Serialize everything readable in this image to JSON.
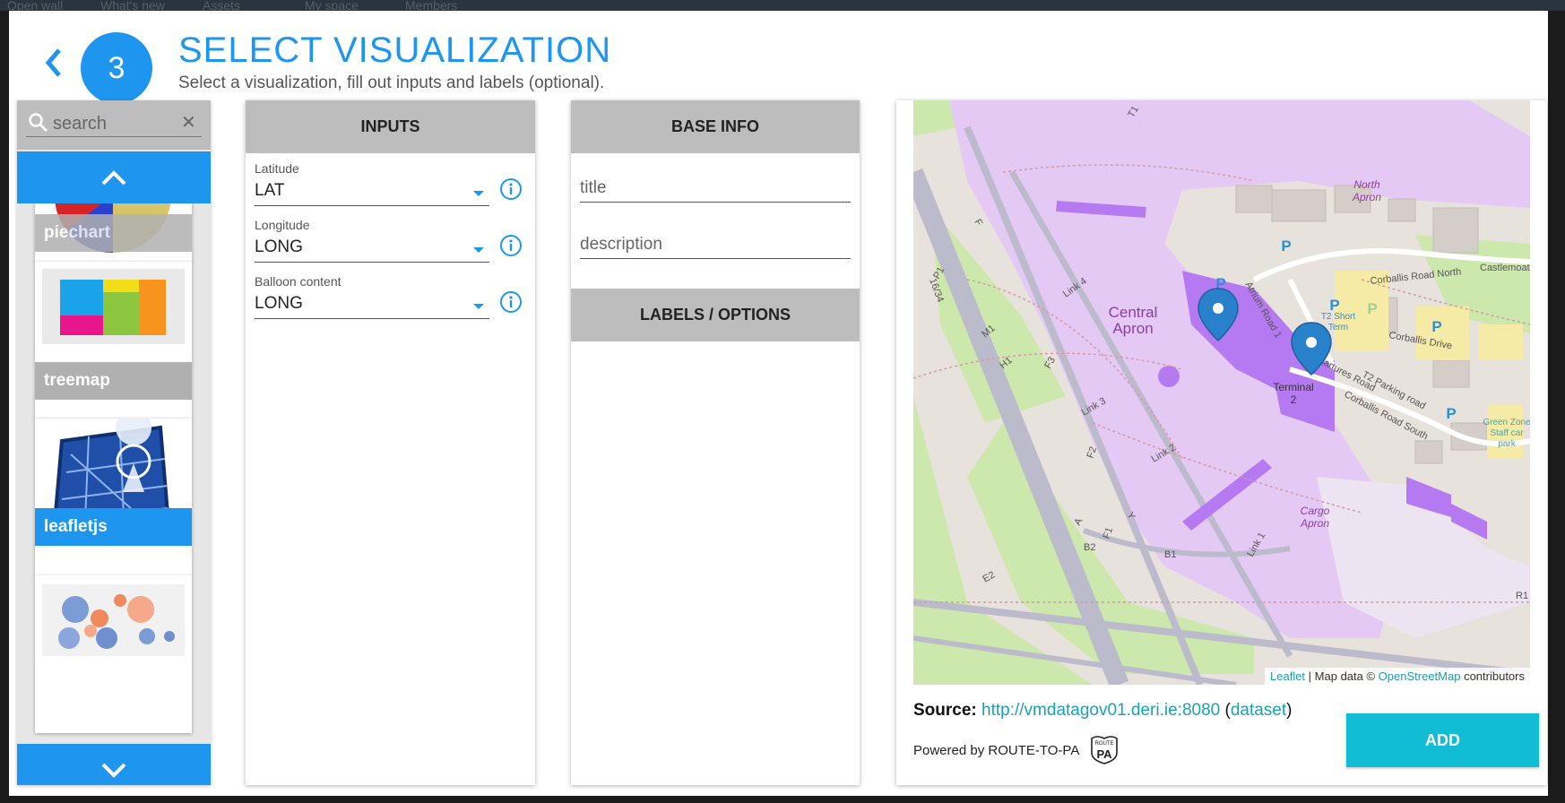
{
  "background_nav": [
    "Open wall",
    "What's new",
    "Assets",
    "My space",
    "Members"
  ],
  "header": {
    "step_number": "3",
    "title": "SELECT VISUALIZATION",
    "subtitle": "Select a visualization, fill out inputs and labels (optional)."
  },
  "gallery": {
    "search_placeholder": "search",
    "clear_glyph": "✕",
    "items": [
      {
        "label": "piechart",
        "selected": false
      },
      {
        "label": "treemap",
        "selected": false
      },
      {
        "label": "leafletjs",
        "selected": true
      },
      {
        "label": "",
        "selected": false
      }
    ]
  },
  "inputs_panel": {
    "heading": "INPUTS",
    "fields": [
      {
        "label": "Latitude",
        "value": "LAT"
      },
      {
        "label": "Longitude",
        "value": "LONG"
      },
      {
        "label": "Balloon content",
        "value": "LONG"
      }
    ]
  },
  "base_panel": {
    "heading": "BASE INFO",
    "title_placeholder": "title",
    "description_placeholder": "description",
    "labels_heading": "LABELS / OPTIONS"
  },
  "preview": {
    "map_labels": {
      "central_apron_1": "Central",
      "central_apron_2": "Apron",
      "north_apron_1": "North",
      "north_apron_2": "Apron",
      "cargo_apron_1": "Cargo",
      "cargo_apron_2": "Apron",
      "terminal_1": "Terminal",
      "terminal_2": "2",
      "link4": "Link 4",
      "link3": "Link 3",
      "link2": "Link 2",
      "link1": "Link 1",
      "runway": "16/34",
      "corballis_north": "Corballis Road North",
      "corballis_south": "Corballis Road South",
      "corballis_drive": "Corballis Drive",
      "t2_departures": "T2 Departures Road",
      "t2_parking": "T2 Parking road",
      "atrium_road": "Atrium Road 1",
      "castlemoat": "Castlemoat",
      "t2_short_term_1": "T2 Short",
      "t2_short_term_2": "Term",
      "green_zone_1": "Green Zone",
      "green_zone_2": "Staff car",
      "green_zone_3": "park",
      "p": "P",
      "m1": "M1",
      "h1": "H1",
      "f3": "F3",
      "f2": "F2",
      "f1": "F1",
      "p1": "P1",
      "b1": "B1",
      "b2": "B2",
      "e2": "E2",
      "t1": "T1",
      "f": "F",
      "a": "A",
      "y": "Y",
      "r1": "R1"
    },
    "attribution": {
      "leaflet": "Leaflet",
      "sep": " | Map data © ",
      "osm": "OpenStreetMap",
      "suffix": " contributors"
    },
    "source_label": "Source:",
    "source_url": "http://vmdatagov01.deri.ie:8080",
    "open_paren": " (",
    "dataset_link": "dataset",
    "close_paren": ")",
    "powered_by": "Powered by ROUTE-TO-PA",
    "badge_top": "ROUTE",
    "badge_text": "PA",
    "add_button": "ADD"
  },
  "colors": {
    "accent": "#1e96f0",
    "add_button": "#11bcd4",
    "panel_header": "#bdbdbd",
    "map_apron": "#e4c9f5",
    "map_terminal": "#b57af2",
    "map_grass": "#cde8ad",
    "map_taxiway": "#bbbbcc"
  }
}
